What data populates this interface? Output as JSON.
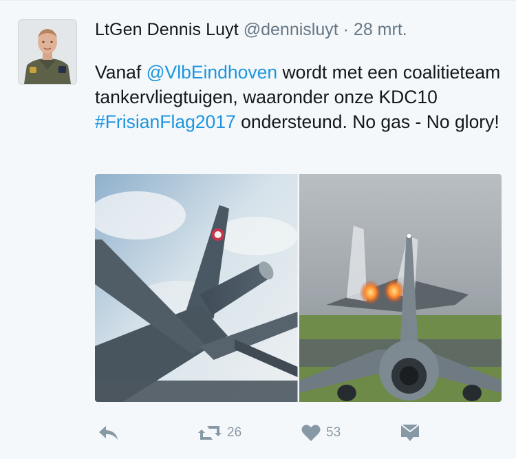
{
  "tweet": {
    "author_name": "LtGen Dennis Luyt",
    "author_handle": "@dennisluyt",
    "separator": "·",
    "timestamp": "28 mrt.",
    "text_parts": {
      "p1": "Vanaf ",
      "mention": "@VlbEindhoven",
      "p2": " wordt met een coalitieteam tankervliegtuigen, waaronder onze KDC10 ",
      "hashtag": "#FrisianFlag2017",
      "p3": " ondersteund. No gas - No glory!"
    },
    "actions": {
      "reply_icon": "reply-icon",
      "retweet_icon": "retweet-icon",
      "retweet_count": "26",
      "like_icon": "heart-icon",
      "like_count": "53",
      "message_icon": "direct-message-icon"
    },
    "colors": {
      "link": "#1b95e0",
      "text": "#14171a",
      "meta": "#657786",
      "action": "#8899a6",
      "background": "#f5f8fa"
    }
  }
}
